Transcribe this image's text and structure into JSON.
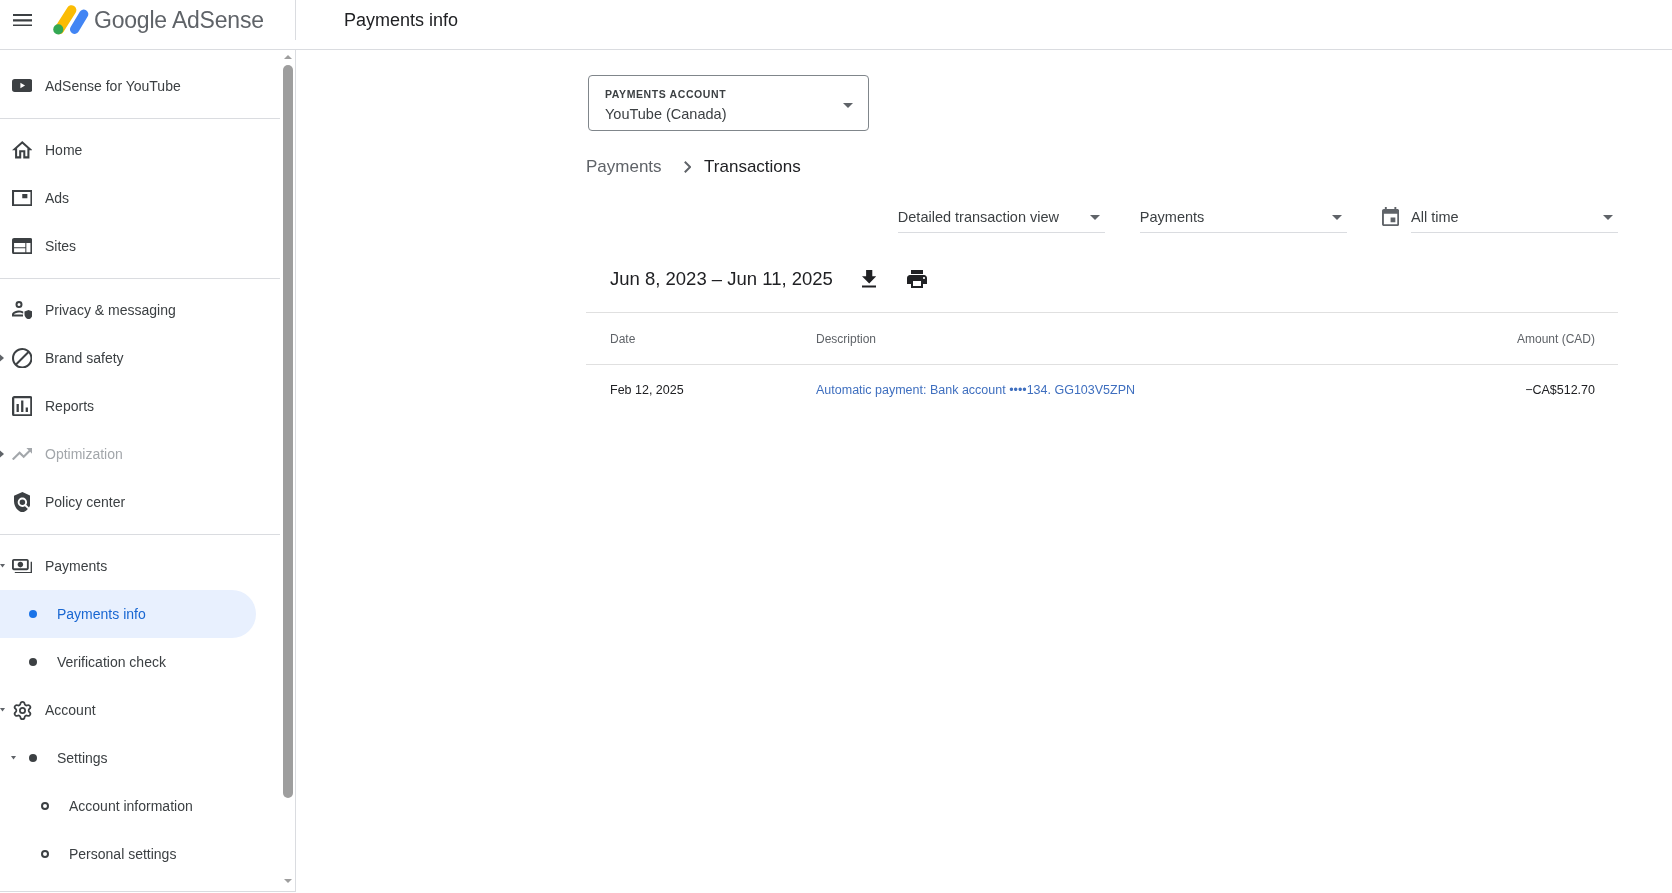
{
  "header": {
    "brand": "Google AdSense",
    "page_title": "Payments info"
  },
  "sidebar": {
    "sections": [
      {
        "items": [
          {
            "label": "AdSense for YouTube",
            "selected": false,
            "disabled": false
          }
        ]
      },
      {
        "items": [
          {
            "label": "Home",
            "selected": false,
            "disabled": false
          },
          {
            "label": "Ads",
            "selected": false,
            "disabled": false
          },
          {
            "label": "Sites",
            "selected": false,
            "disabled": false
          }
        ]
      },
      {
        "items": [
          {
            "label": "Privacy & messaging",
            "selected": false,
            "disabled": false
          },
          {
            "label": "Brand safety",
            "selected": false,
            "disabled": false,
            "expanded": false
          },
          {
            "label": "Reports",
            "selected": false,
            "disabled": false
          },
          {
            "label": "Optimization",
            "selected": false,
            "disabled": true,
            "expanded": false
          },
          {
            "label": "Policy center",
            "selected": false,
            "disabled": false
          }
        ]
      },
      {
        "items": [
          {
            "label": "Payments",
            "selected": false,
            "disabled": false,
            "expanded": true,
            "children": [
              {
                "label": "Payments info",
                "selected": true,
                "disabled": false
              },
              {
                "label": "Verification check",
                "selected": false,
                "disabled": false
              }
            ]
          },
          {
            "label": "Account",
            "selected": false,
            "disabled": false,
            "expanded": true,
            "children": [
              {
                "label": "Settings",
                "selected": false,
                "disabled": false,
                "expanded": true,
                "children": [
                  {
                    "label": "Account information",
                    "selected": false,
                    "disabled": false
                  },
                  {
                    "label": "Personal settings",
                    "selected": false,
                    "disabled": false
                  }
                ]
              }
            ]
          }
        ]
      }
    ]
  },
  "payments_account": {
    "label": "PAYMENTS ACCOUNT",
    "value": "YouTube (Canada)"
  },
  "breadcrumb": [
    {
      "label": "Payments",
      "current": false
    },
    {
      "label": "Transactions",
      "current": true
    }
  ],
  "filters": [
    {
      "kind": "select",
      "value": "Detailed transaction view"
    },
    {
      "kind": "select",
      "value": "Payments"
    },
    {
      "kind": "date",
      "value": "All time"
    }
  ],
  "date_range": "Jun 8, 2023 – Jun 11, 2025",
  "table": {
    "columns": [
      "Date",
      "Description",
      "Amount (CAD)"
    ],
    "rows": [
      {
        "date": "Feb 12, 2025",
        "description": "Automatic payment: Bank account ••••134. GG103V5ZPN",
        "amount": "−CA$512.70"
      }
    ]
  }
}
